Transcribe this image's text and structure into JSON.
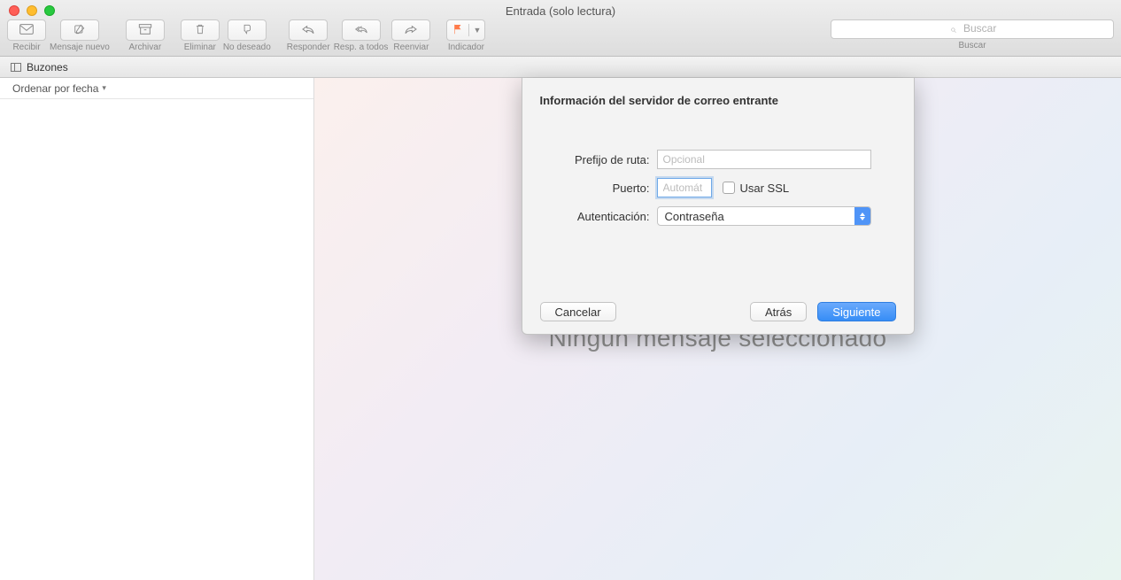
{
  "window": {
    "title": "Entrada (solo lectura)"
  },
  "toolbar": {
    "recibir": "Recibir",
    "nuevo": "Mensaje nuevo",
    "archivar": "Archivar",
    "eliminar": "Eliminar",
    "nodeseado": "No deseado",
    "responder": "Responder",
    "resp_todos": "Resp. a todos",
    "reenviar": "Reenviar",
    "indicador": "Indicador",
    "buscar_placeholder": "Buscar",
    "buscar_label": "Buscar"
  },
  "secbar": {
    "buzones": "Buzones"
  },
  "sidebar": {
    "sort": "Ordenar por fecha"
  },
  "content": {
    "empty": "Ningún mensaje seleccionado"
  },
  "sheet": {
    "title": "Información del servidor de correo entrante",
    "prefix_label": "Prefijo de ruta:",
    "prefix_placeholder": "Opcional",
    "port_label": "Puerto:",
    "port_placeholder": "Automát",
    "ssl_label": "Usar SSL",
    "auth_label": "Autenticación:",
    "auth_value": "Contraseña",
    "cancel": "Cancelar",
    "back": "Atrás",
    "next": "Siguiente"
  }
}
